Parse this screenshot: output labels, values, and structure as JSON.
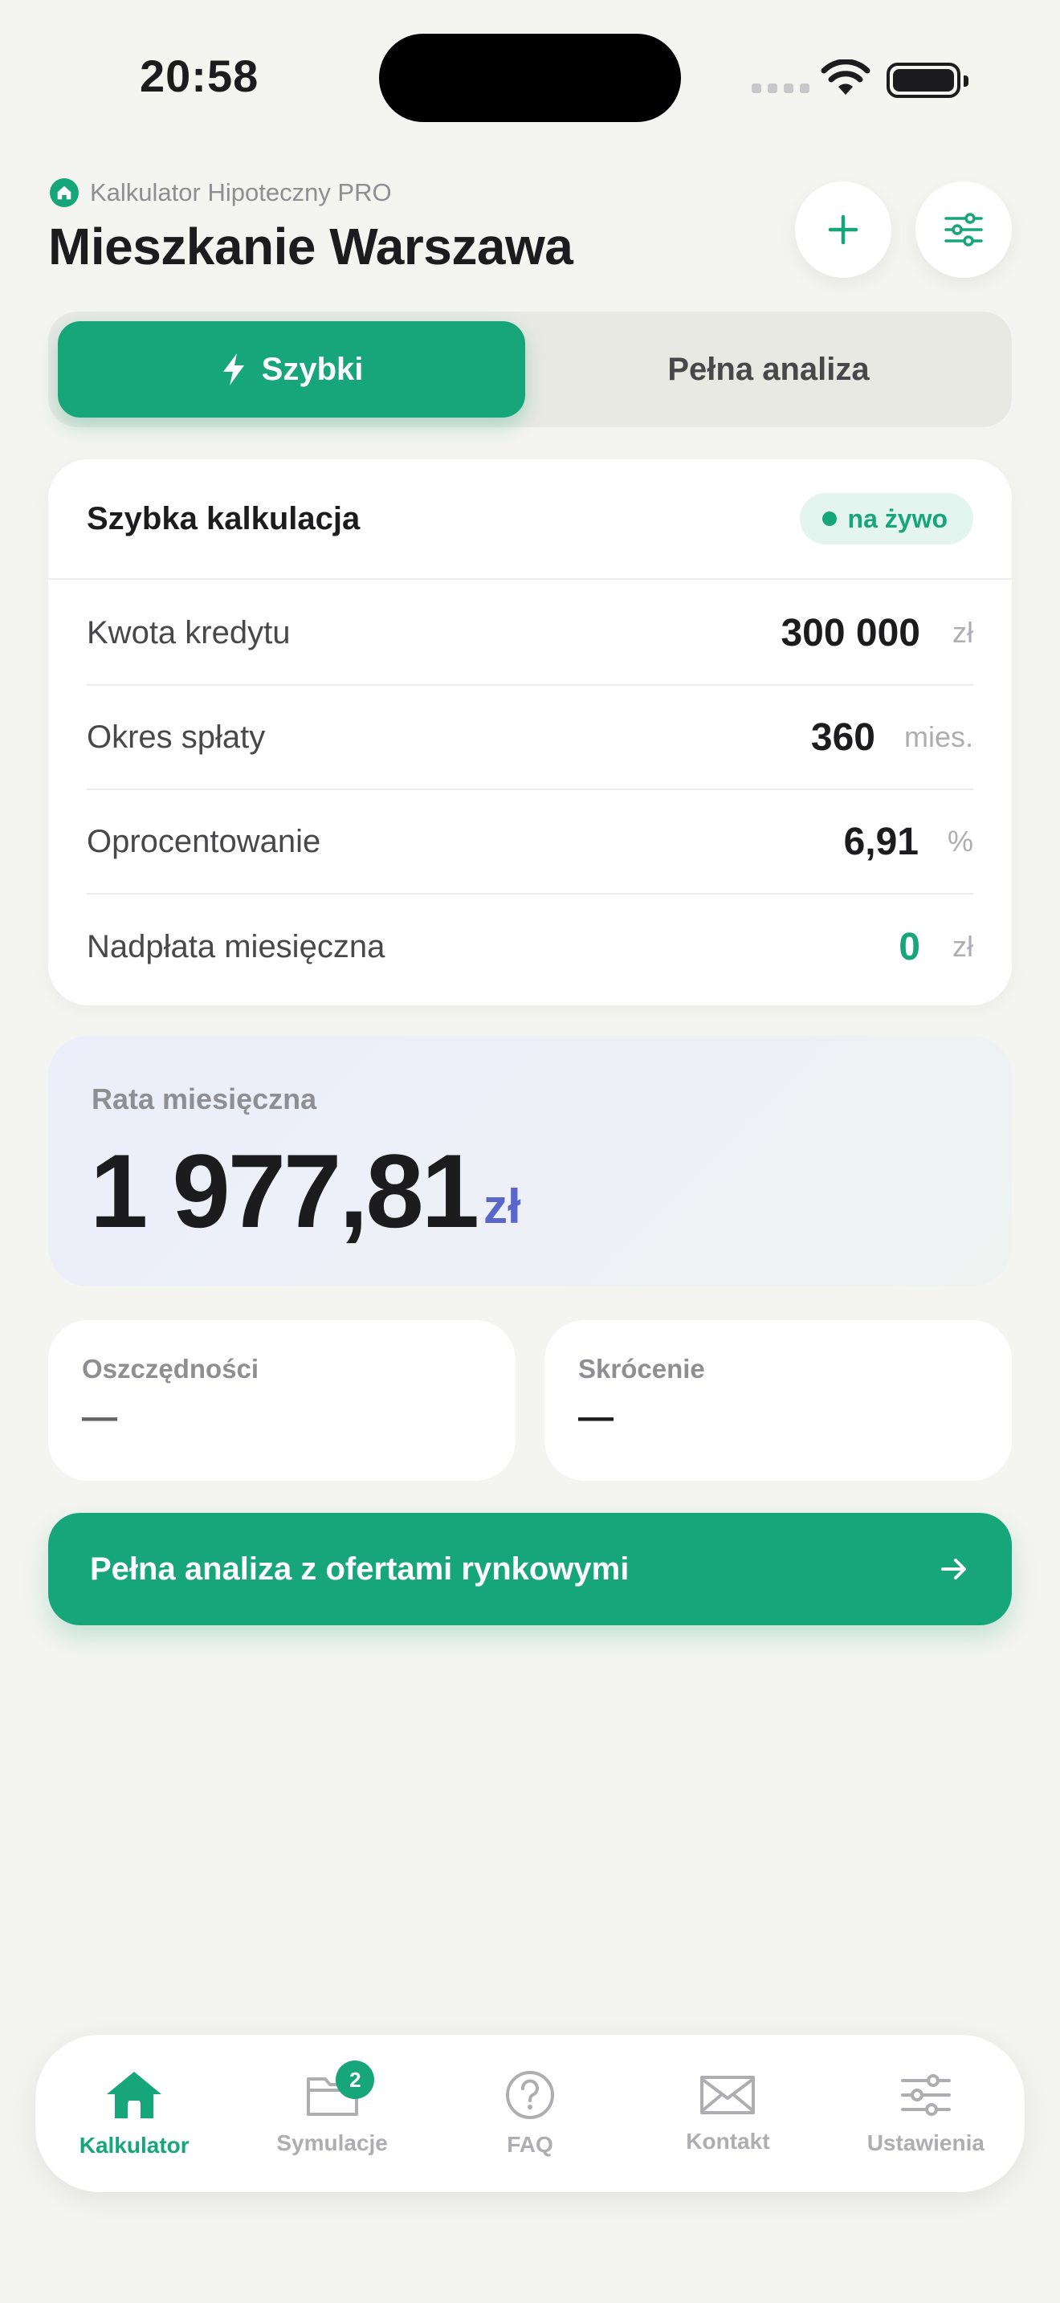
{
  "status_bar": {
    "time": "20:58"
  },
  "header": {
    "app_name": "Kalkulator Hipoteczny PRO",
    "title": "Mieszkanie Warszawa"
  },
  "tabs": {
    "quick": "Szybki",
    "full": "Pełna analiza"
  },
  "calc": {
    "title": "Szybka kalkulacja",
    "badge": "na żywo",
    "rows": [
      {
        "label": "Kwota kredytu",
        "value": "300 000",
        "unit": "zł"
      },
      {
        "label": "Okres spłaty",
        "value": "360",
        "unit": "mies."
      },
      {
        "label": "Oprocentowanie",
        "value": "6,91",
        "unit": "%"
      },
      {
        "label": "Nadpłata miesięczna",
        "value": "0",
        "unit": "zł"
      }
    ]
  },
  "rate": {
    "label": "Rata miesięczna",
    "value": "1 977,81",
    "unit": "zł"
  },
  "savings": {
    "label": "Oszczędności",
    "value": "—"
  },
  "shortening": {
    "label": "Skrócenie",
    "value": "—"
  },
  "cta": {
    "label": "Pełna analiza z ofertami rynkowymi"
  },
  "nav": {
    "items": [
      {
        "label": "Kalkulator",
        "icon": "home-icon"
      },
      {
        "label": "Symulacje",
        "icon": "folder-icon",
        "badge": "2"
      },
      {
        "label": "FAQ",
        "icon": "question-icon"
      },
      {
        "label": "Kontakt",
        "icon": "mail-icon"
      },
      {
        "label": "Ustawienia",
        "icon": "sliders-icon"
      }
    ]
  },
  "colors": {
    "accent": "#17a57a",
    "background": "#f4f4f0",
    "rate_unit": "#5a66c9"
  }
}
